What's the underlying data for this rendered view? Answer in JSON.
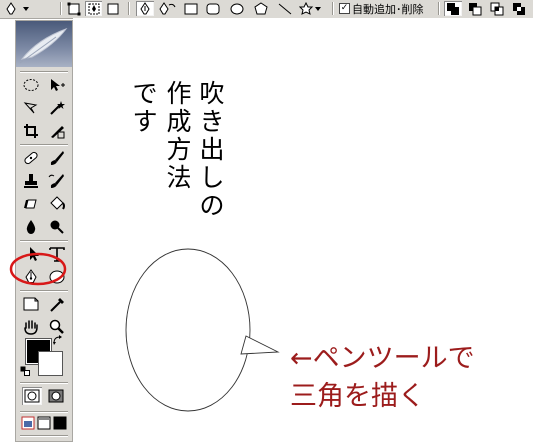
{
  "options_bar": {
    "auto_add_delete_label": "自動追加･削除",
    "auto_add_delete_checked": true
  },
  "tool_palette": {
    "tools": [
      {
        "name": "marquee-tool"
      },
      {
        "name": "move-tool"
      },
      {
        "name": "lasso-tool"
      },
      {
        "name": "magic-wand-tool"
      },
      {
        "name": "crop-tool"
      },
      {
        "name": "slice-tool"
      },
      {
        "name": "healing-brush-tool"
      },
      {
        "name": "brush-tool"
      },
      {
        "name": "clone-stamp-tool"
      },
      {
        "name": "history-brush-tool"
      },
      {
        "name": "eraser-tool"
      },
      {
        "name": "paint-bucket-tool"
      },
      {
        "name": "blur-tool"
      },
      {
        "name": "burn-tool"
      },
      {
        "name": "path-selection-tool"
      },
      {
        "name": "type-tool"
      },
      {
        "name": "pen-tool"
      },
      {
        "name": "ellipse-tool"
      },
      {
        "name": "notes-tool"
      },
      {
        "name": "eyedropper-tool"
      },
      {
        "name": "hand-tool"
      },
      {
        "name": "zoom-tool"
      }
    ],
    "foreground_color": "#000000",
    "background_color": "#ffffff"
  },
  "canvas": {
    "title_col1": "吹き出しの",
    "title_col2": "作成方法",
    "title_col3": "です",
    "caption_line1": "←ペンツールで",
    "caption_line2": "三角を描く",
    "caption_color": "#9c1c1c",
    "highlight_color": "#d81818"
  }
}
